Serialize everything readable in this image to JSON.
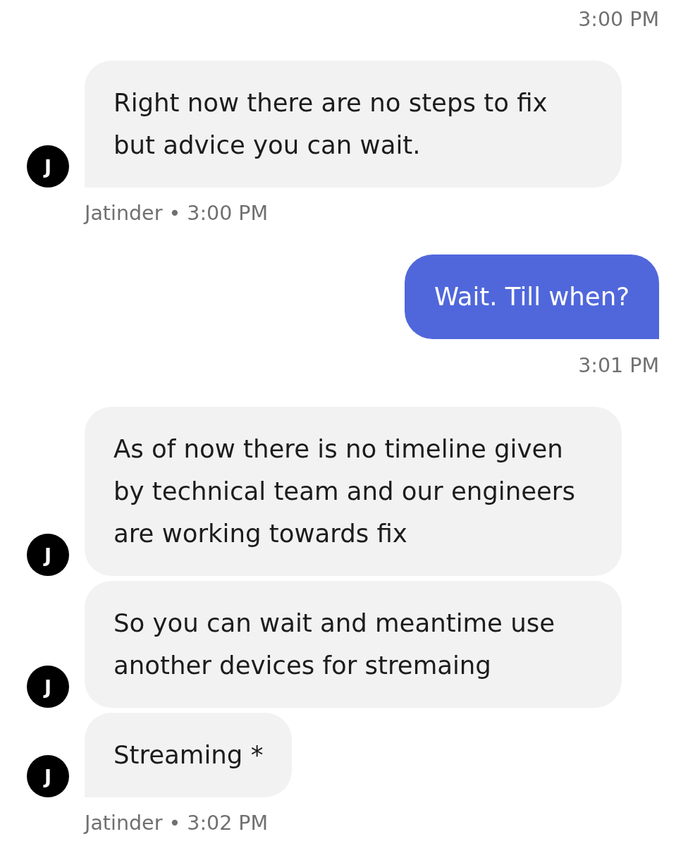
{
  "conversation": [
    {
      "kind": "time",
      "text": "3:00 PM"
    },
    {
      "kind": "incoming",
      "messages": [
        {
          "avatar": "J",
          "text": "Right now there are no steps to fix but advice you can wait."
        }
      ],
      "byline": "Jatinder • 3:00 PM"
    },
    {
      "kind": "outgoing",
      "messages": [
        {
          "text": "Wait. Till when?"
        }
      ],
      "time": "3:01 PM"
    },
    {
      "kind": "incoming",
      "messages": [
        {
          "avatar": "J",
          "text": "As of now there is no timeline given by technical team and our engineers are working towards fix"
        },
        {
          "avatar": "J",
          "text": "So you can wait and meantime use another devices for stremaing"
        },
        {
          "avatar": "J",
          "text": "Streaming *"
        }
      ],
      "byline": "Jatinder • 3:02 PM"
    }
  ]
}
